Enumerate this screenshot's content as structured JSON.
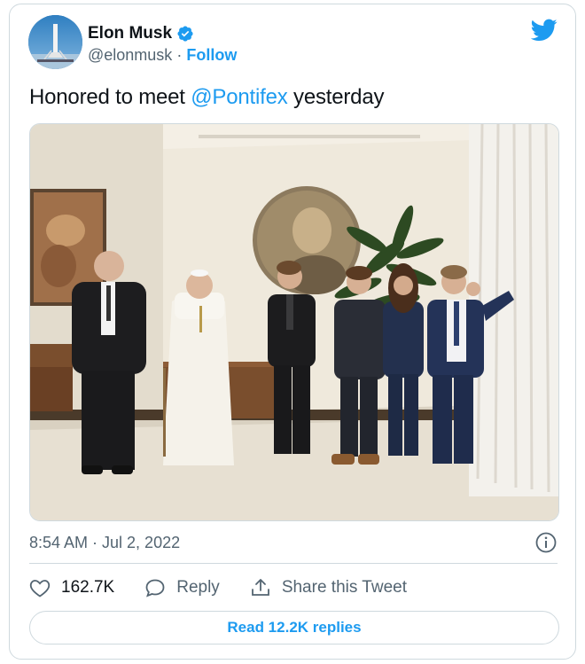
{
  "author": {
    "name": "Elon Musk",
    "handle": "@elonmusk",
    "separator": "·",
    "follow_label": "Follow",
    "verified": true
  },
  "tweet": {
    "text_before": "Honored to meet ",
    "mention": "@Pontifex",
    "text_after": " yesterday",
    "timestamp": "8:54 AM · Jul 2, 2022"
  },
  "actions": {
    "likes": "162.7K",
    "reply_label": "Reply",
    "share_label": "Share this Tweet"
  },
  "footer": {
    "read_replies_label": "Read 12.2K replies"
  },
  "colors": {
    "accent": "#1d9bf0",
    "text": "#0f1419",
    "secondary": "#536471",
    "border": "#cfd9de"
  },
  "icons": [
    "twitter-bird-icon",
    "verified-badge-icon",
    "info-icon",
    "heart-icon",
    "reply-bubble-icon",
    "share-icon"
  ]
}
